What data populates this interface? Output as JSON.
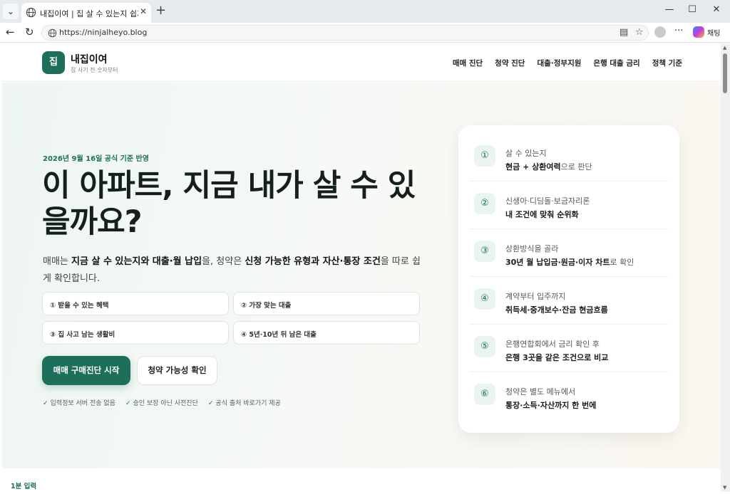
{
  "browser": {
    "tab_title": "내집이여 | 집 살 수 있는지 쉽게 확",
    "url": "https://ninjalheyo.blog",
    "copilot_label": "채팅",
    "icons": [
      "tab-menu-icon",
      "globe-icon",
      "close-icon",
      "plus-icon",
      "minimize-icon",
      "maximize-icon",
      "back-icon",
      "reload-icon",
      "reader-icon",
      "favorite-star-icon",
      "profile-icon",
      "more-icon",
      "copilot-icon"
    ]
  },
  "site": {
    "logo_letter": "집",
    "brand": "내집이여",
    "tagline": "집 사기 전 숫자부터",
    "nav": [
      "매매 진단",
      "청약 진단",
      "대출·정부지원",
      "은행 대출 금리",
      "정책 기준"
    ]
  },
  "hero": {
    "date": "2026년 9월 16일 공식 기준 반영",
    "title": "이 아파트, 지금 내가 살 수 있을까요?",
    "desc": {
      "p1": "매매는 ",
      "b1": "지금 살 수 있는지와 대출·월 납입",
      "p2": "을, 청약은 ",
      "b2": "신청 가능한 유형과 자산·통장 조건",
      "p3": "을 따로 쉽게 확인합니다."
    },
    "chips": [
      "① 받을 수 있는 혜택",
      "② 가장 맞는 대출",
      "③ 집 사고 남는 생활비",
      "④ 5년·10년 뒤 남은 대출"
    ],
    "primary_button": "매매 구매진단 시작",
    "secondary_button": "청약 가능성 확인",
    "assurances": [
      "입력정보 서버 전송 없음",
      "승인 보장 아닌 사전진단",
      "공식 출처 바로가기 제공"
    ],
    "check_mark": "✓"
  },
  "steps": [
    {
      "num": "①",
      "sub": "살 수 있는지",
      "main": "현금 + 상환여력",
      "rest": "으로 판단"
    },
    {
      "num": "②",
      "sub": "신생아·디딤돌·보금자리론",
      "main": "내 조건에 맞춰 순위화",
      "rest": ""
    },
    {
      "num": "③",
      "sub": "상환방식을 골라",
      "main": "30년 월 납입금·원금·이자 차트",
      "rest": "로 확인"
    },
    {
      "num": "④",
      "sub": "계약부터 입주까지",
      "main": "취득세·중개보수·잔금 현금흐름",
      "rest": ""
    },
    {
      "num": "⑤",
      "sub": "은행연합회에서 금리 확인 후",
      "main": "은행 3곳을 같은 조건으로 비교",
      "rest": ""
    },
    {
      "num": "⑥",
      "sub": "청약은 별도 메뉴에서",
      "main": "통장·소득·자산까지 한 번에",
      "rest": ""
    }
  ],
  "next_section_label": "1분 입력",
  "colors": {
    "brand_green": "#1e6e5c",
    "hero_bg_start": "#eef6f2",
    "hero_bg_end": "#fbf7f0"
  }
}
